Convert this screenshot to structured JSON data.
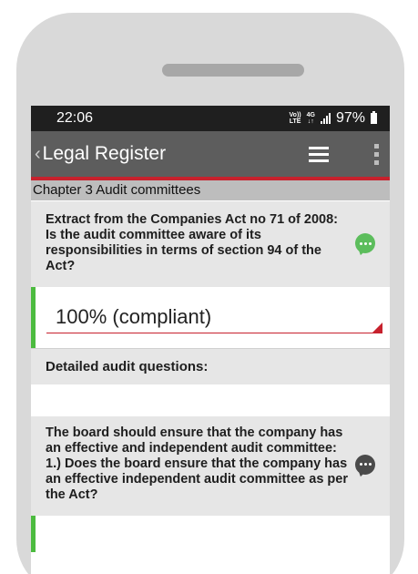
{
  "status_bar": {
    "time": "22:06",
    "volte_top": "Vo))",
    "volte_bottom": "LTE",
    "network": "4G",
    "battery": "97%"
  },
  "app_bar": {
    "title": "Legal Register",
    "icons": [
      "back-chevron",
      "list-icon",
      "more-vertical-icon"
    ]
  },
  "chapter": {
    "title": "Chapter 3 Audit committees"
  },
  "questions": [
    {
      "text": "Extract from the Companies Act no 71 of 2008: Is the audit committee aware of its responsibilities in terms of section 94 of the Act?",
      "answer": "100% (compliant)",
      "comment_color": "#5cbd5c"
    },
    {
      "text": "The board should ensure that the company has an effective and independent audit committee: 1.) Does the board ensure that the company has an effective independent audit committee as per the Act?",
      "comment_color": "#4a4a4a"
    }
  ],
  "section_label": "Detailed audit questions:",
  "colors": {
    "accent_red": "#c7212d",
    "compliant_green": "#4cbb3f",
    "app_bar": "#5d5d5d"
  }
}
